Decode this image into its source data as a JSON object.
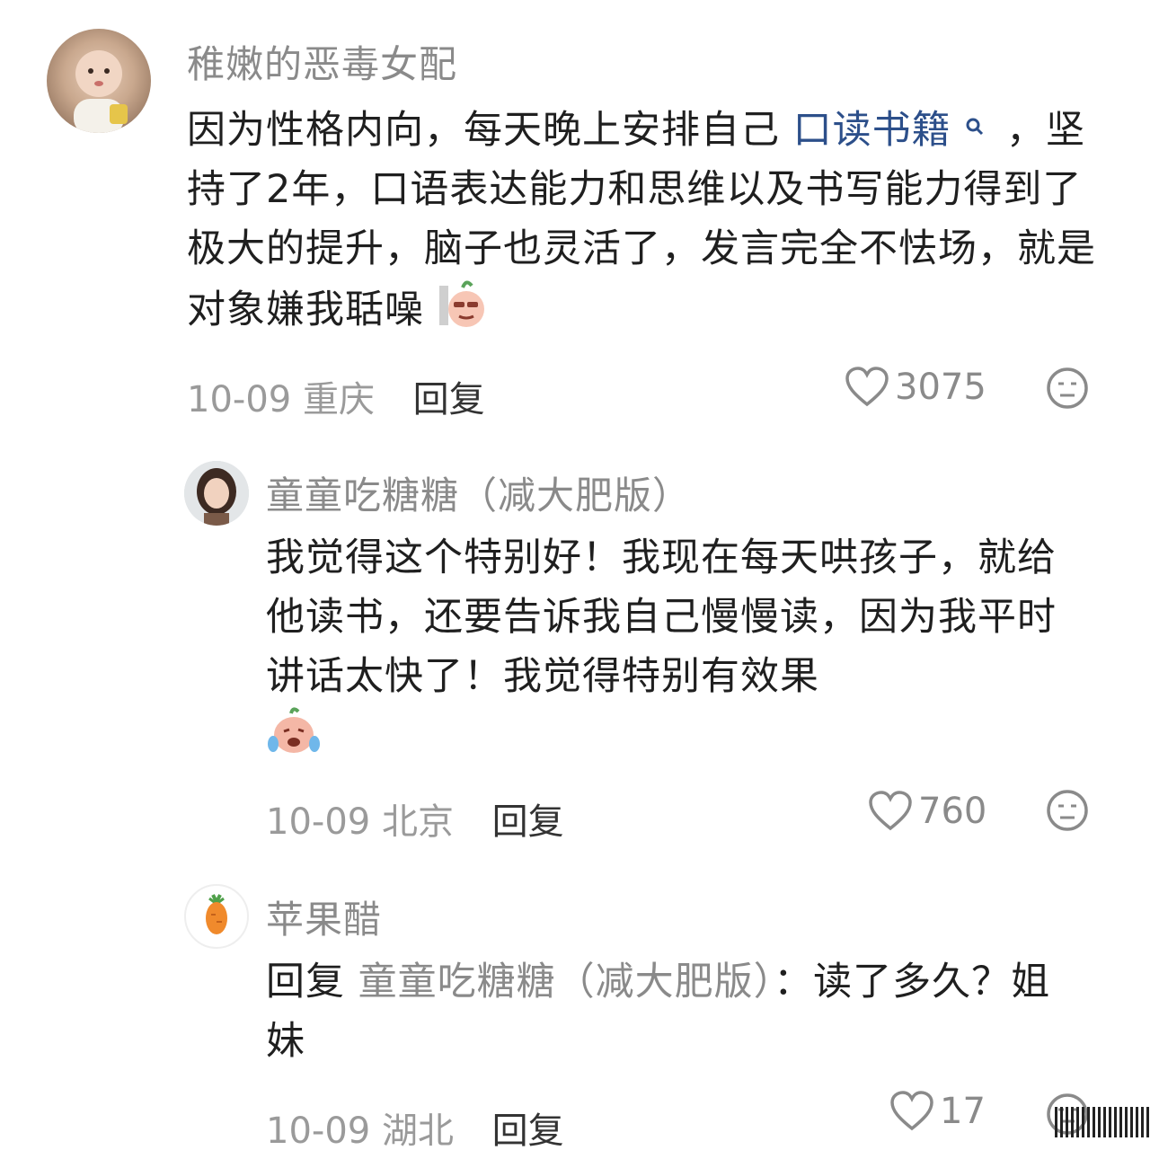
{
  "comments": [
    {
      "username": "稚嫩的恶毒女配",
      "content_part1": "因为性格内向，每天晚上安排自己",
      "link_text": "口读书籍",
      "content_part2": "，坚持了2年，口语表达能力和思维以及书写能力得到了极大的提升，脑子也灵活了，发言完全不怯场，就是对象嫌我聒噪",
      "date": "10-09",
      "location": "重庆",
      "reply_label": "回复",
      "likes": "3075"
    },
    {
      "username": "童童吃糖糖（减大肥版）",
      "content": "我觉得这个特别好！我现在每天哄孩子，就给他读书，还要告诉我自己慢慢读，因为我平时讲话太快了！我觉得特别有效果",
      "date": "10-09",
      "location": "北京",
      "reply_label": "回复",
      "likes": "760"
    },
    {
      "username": "苹果醋",
      "reply_prefix": "回复",
      "reply_target": "童童吃糖糖（减大肥版）",
      "content": "：读了多久？姐妹",
      "date": "10-09",
      "location": "湖北",
      "reply_label": "回复",
      "likes": "17"
    }
  ],
  "icons": {
    "like": "heart-outline-icon",
    "reaction": "neutral-face-icon",
    "search": "search-icon"
  },
  "colors": {
    "text": "#1f1f1f",
    "username": "#8a8a8a",
    "link": "#2c4f8a"
  }
}
